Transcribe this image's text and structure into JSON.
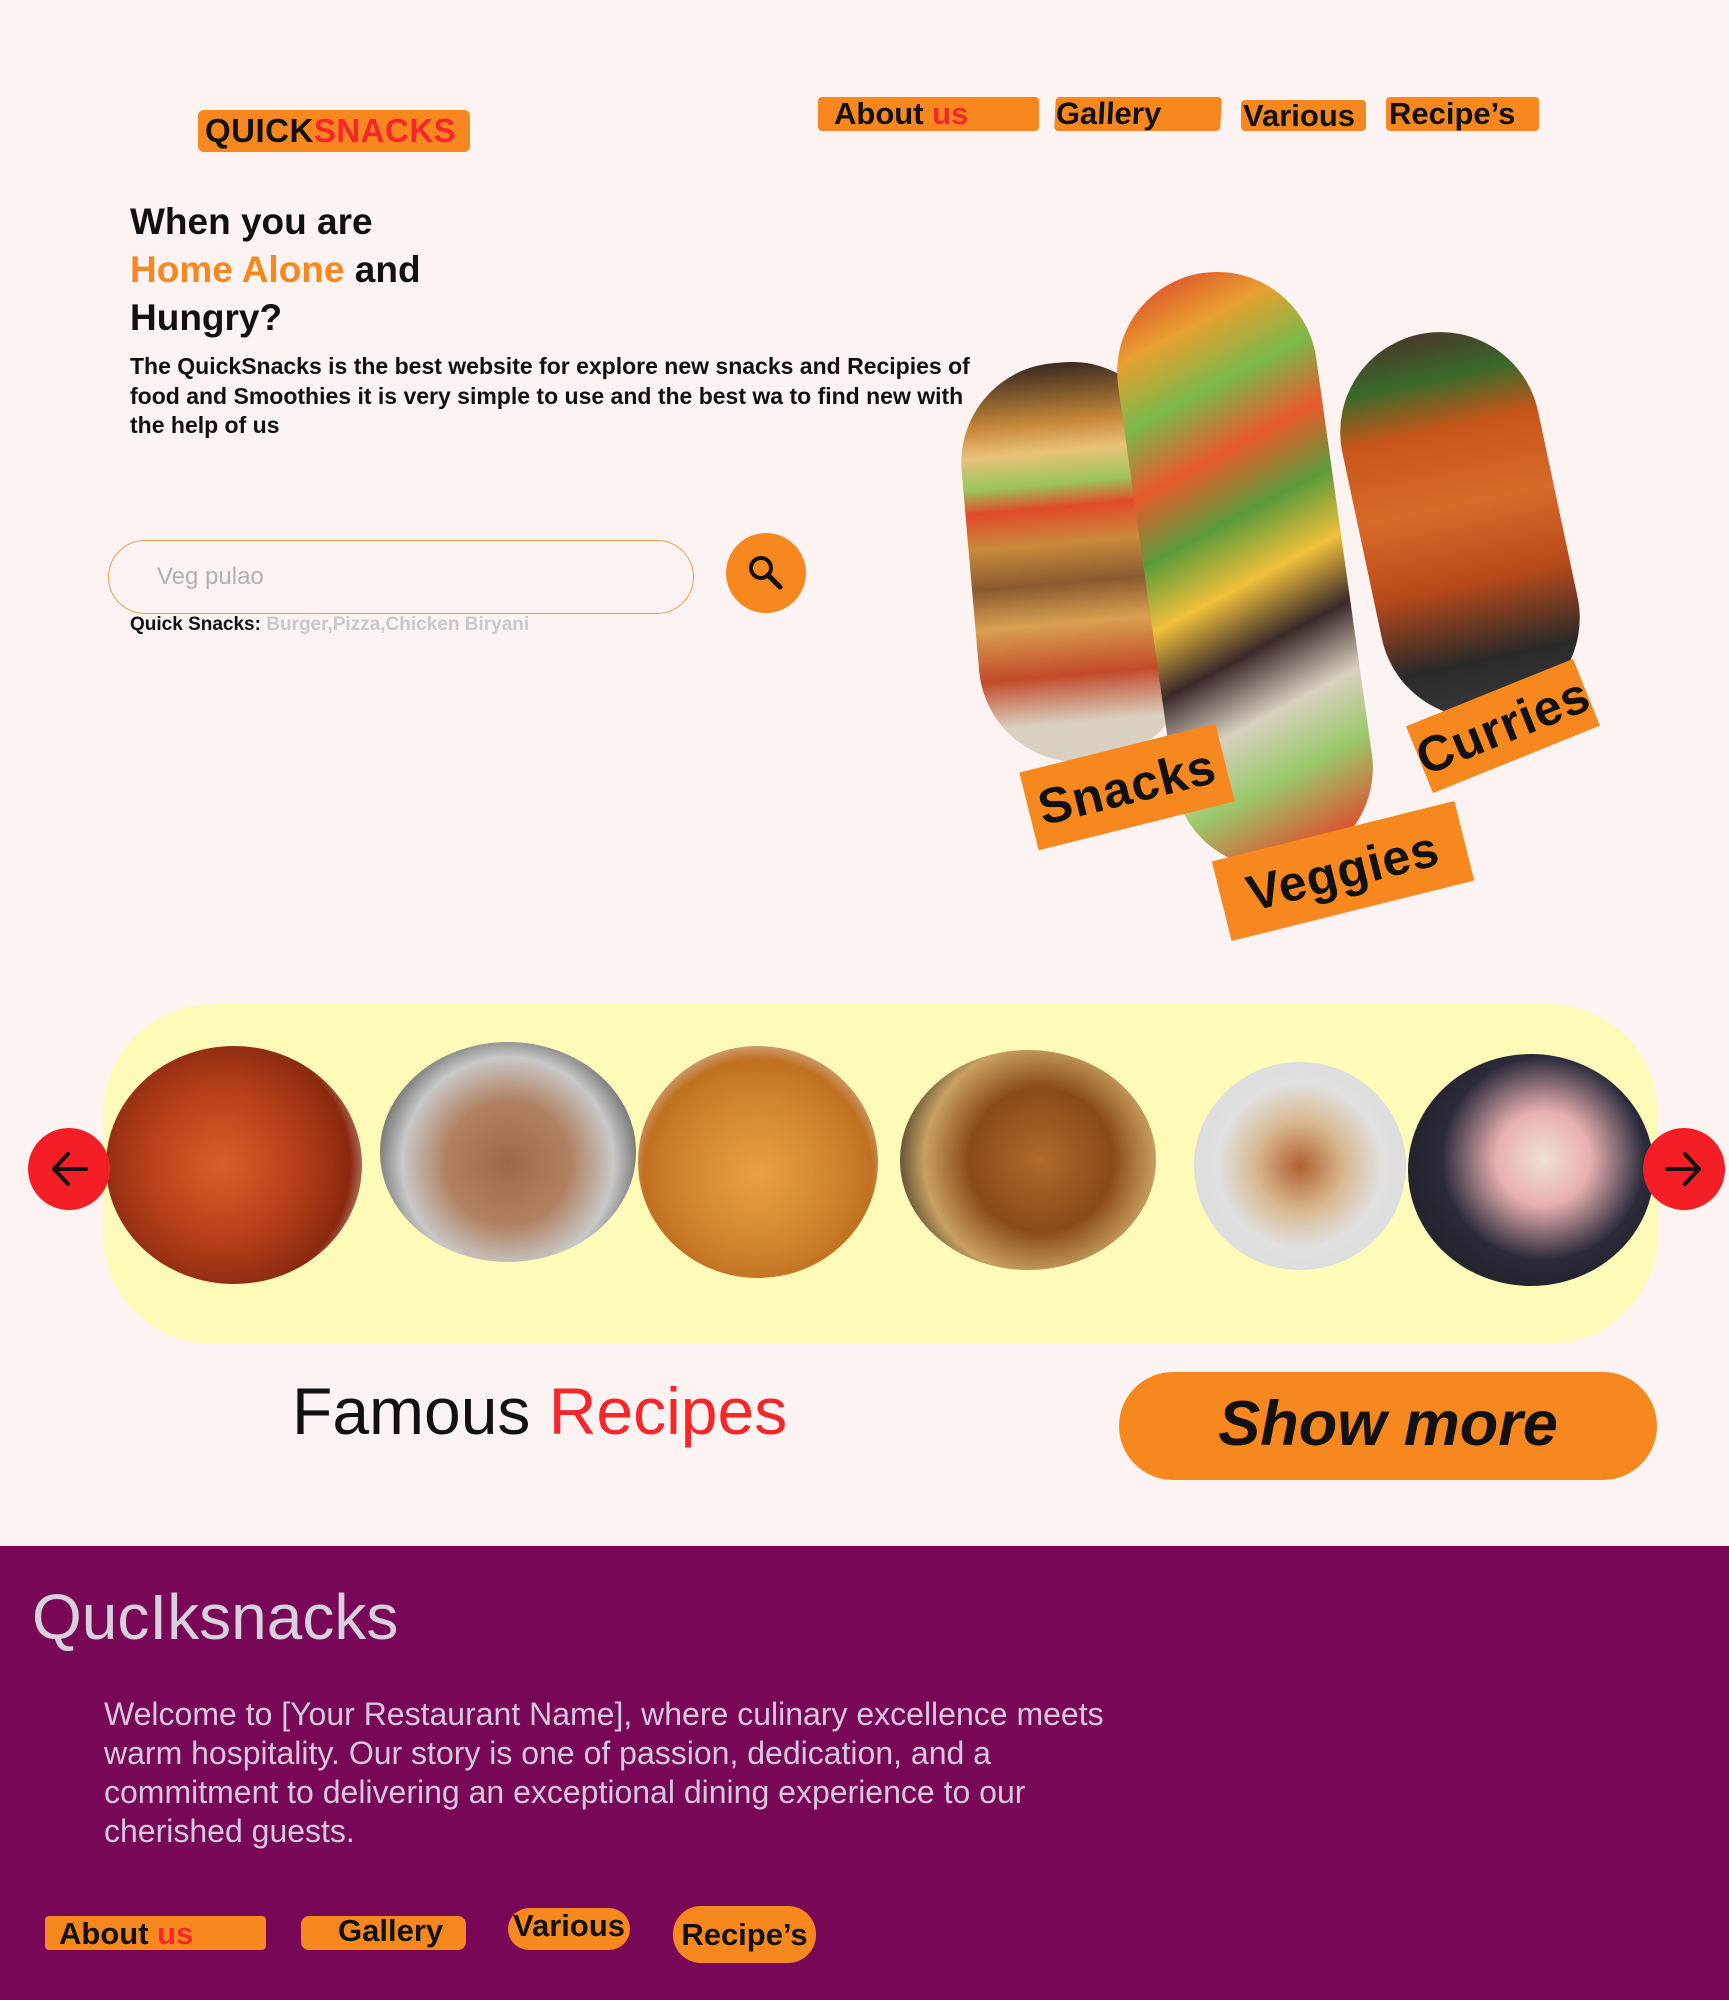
{
  "header": {
    "logo_part1": "QUICK",
    "logo_part2": "SNACKS",
    "nav": {
      "about_label": "About ",
      "about_accent": "us",
      "gallery": "Gallery",
      "various": "Various",
      "recipes": "Recipe’s"
    }
  },
  "hero": {
    "line1": "When you are",
    "line2_orange": "Home Alone",
    "line2_rest": " and",
    "line3": "Hungry?",
    "description": "The QuickSnacks is the best website for explore new snacks and Recipies of food and Smoothies it is very simple to use and the best wa to find new with the help of us",
    "search_placeholder": "Veg pulao",
    "quick_label": "Quick Snacks:",
    "quick_list": " Burger,Pizza,Chicken Biryani"
  },
  "categories": [
    {
      "label": "Snacks"
    },
    {
      "label": "Veggies"
    },
    {
      "label": "Curries"
    }
  ],
  "carousel": {
    "items": [
      "paneer-curry",
      "chocolate-cake",
      "fried-chicken",
      "cutlets",
      "sandwich-bars",
      "ice-cream"
    ]
  },
  "famous": {
    "word1": "Famous ",
    "word2": "Recipes"
  },
  "show_more": "Show more",
  "footer": {
    "title": "QucIksnacks",
    "text": "Welcome to [Your Restaurant Name], where culinary excellence meets warm hospitality. Our story is one of passion, dedication, and a commitment to delivering an exceptional dining experience to our cherished guests.",
    "nav": {
      "about_label": "About ",
      "about_accent": "us",
      "gallery": "Gallery",
      "various": "Various",
      "recipes": "Recipe’s"
    }
  },
  "colors": {
    "background": "#fdf3f2",
    "orange": "#f6881f",
    "red": "#f7262a",
    "footer": "#790758",
    "carousel_bg": "#fefab8"
  }
}
